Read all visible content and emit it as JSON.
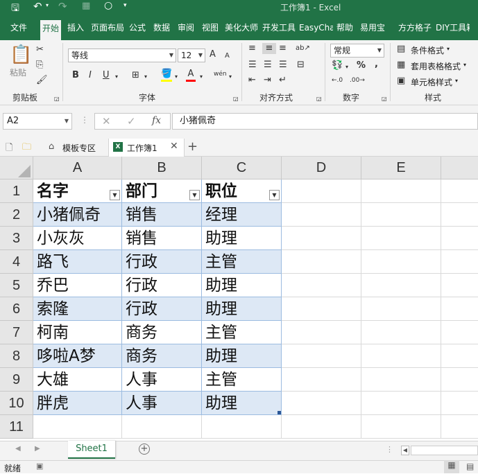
{
  "window": {
    "title": "工作簿1  -  Excel"
  },
  "ribbon_tabs": [
    {
      "label": "文件"
    },
    {
      "label": "开始",
      "active": true
    },
    {
      "label": "插入"
    },
    {
      "label": "页面布局"
    },
    {
      "label": "公式"
    },
    {
      "label": "数据"
    },
    {
      "label": "审阅"
    },
    {
      "label": "视图"
    },
    {
      "label": "美化大师"
    },
    {
      "label": "开发工具"
    },
    {
      "label": "EasyCharts"
    },
    {
      "label": "帮助"
    },
    {
      "label": "易用宝"
    },
    {
      "label": "方方格子"
    },
    {
      "label": "DIY工具箱"
    }
  ],
  "ribbon": {
    "clipboard": {
      "paste_label": "粘贴",
      "group_label": "剪贴板"
    },
    "font": {
      "name": "等线",
      "size": "12",
      "group_label": "字体",
      "bold": "B",
      "italic": "I",
      "underline": "U",
      "grow": "A",
      "shrink": "A",
      "font_color": "A",
      "wen": "wén"
    },
    "alignment": {
      "group_label": "对齐方式"
    },
    "number": {
      "format": "常规",
      "percent": "%",
      "comma": ",",
      "group_label": "数字"
    },
    "styles": {
      "conditional": "条件格式",
      "table": "套用表格格式",
      "cell": "单元格样式",
      "group_label": "样式"
    }
  },
  "formula_bar": {
    "name_box": "A2",
    "content": "小猪佩奇"
  },
  "doc_tabs": [
    {
      "label": "模板专区"
    },
    {
      "label": "工作簿1"
    }
  ],
  "columns": [
    "A",
    "B",
    "C",
    "D",
    "E"
  ],
  "rows": [
    "1",
    "2",
    "3",
    "4",
    "5",
    "6",
    "7",
    "8",
    "9",
    "10",
    "11"
  ],
  "table": {
    "headers": [
      "名字",
      "部门",
      "职位"
    ],
    "data": [
      [
        "小猪佩奇",
        "销售",
        "经理"
      ],
      [
        "小灰灰",
        "销售",
        "助理"
      ],
      [
        "路飞",
        "行政",
        "主管"
      ],
      [
        "乔巴",
        "行政",
        "助理"
      ],
      [
        "索隆",
        "行政",
        "助理"
      ],
      [
        "柯南",
        "商务",
        "主管"
      ],
      [
        "哆啦A梦",
        "商务",
        "助理"
      ],
      [
        "大雄",
        "人事",
        "主管"
      ],
      [
        "胖虎",
        "人事",
        "助理"
      ]
    ]
  },
  "sheet_tabs": [
    {
      "label": "Sheet1"
    }
  ],
  "status": {
    "ready": "就绪"
  },
  "colors": {
    "excel_green": "#217346",
    "band": "#dde8f5"
  }
}
